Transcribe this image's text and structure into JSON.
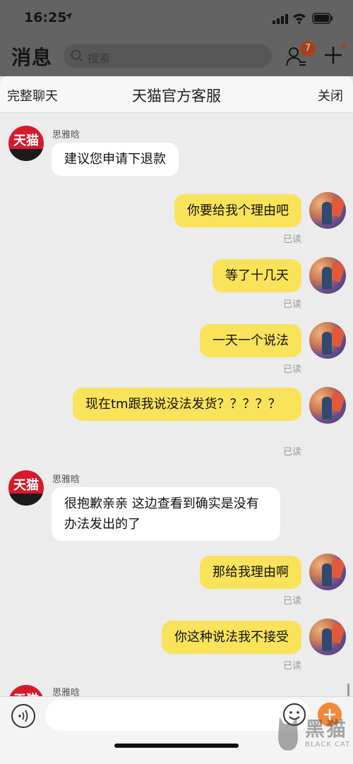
{
  "status_bar": {
    "time": "16:25"
  },
  "app_header": {
    "title": "消息",
    "search_placeholder": "搜索",
    "badge_count": "7"
  },
  "sheet": {
    "left_action": "完整聊天",
    "title": "天猫官方客服",
    "right_action": "关闭"
  },
  "tmall_avatar_text": "天猫",
  "messages": [
    {
      "from": "agent",
      "sender": "思雅晗",
      "text": "建议您申请下退款"
    },
    {
      "from": "me",
      "text": "你要给我个理由吧",
      "status": "已读"
    },
    {
      "from": "me",
      "text": "等了十几天",
      "status": "已读"
    },
    {
      "from": "me",
      "text": "一天一个说法",
      "status": "已读"
    },
    {
      "from": "me",
      "text": "现在tm跟我说没法发货？？？？？",
      "status": "已读"
    },
    {
      "from": "agent",
      "sender": "思雅晗",
      "text": "很抱歉亲亲 这边查看到确实是没有办法发出的了"
    },
    {
      "from": "me",
      "text": "那给我理由啊",
      "status": "已读"
    },
    {
      "from": "me",
      "text": "你这种说法我不接受",
      "status": "已读"
    },
    {
      "from": "agent",
      "sender": "思雅晗",
      "text": ""
    }
  ],
  "watermark": {
    "cn": "黑猫",
    "en": "BLACK CAT"
  },
  "colors": {
    "bubble_out": "#f9e35a",
    "bubble_in": "#ffffff",
    "tmall_red": "#d51a2b",
    "accent_orange": "#f08a3a"
  }
}
